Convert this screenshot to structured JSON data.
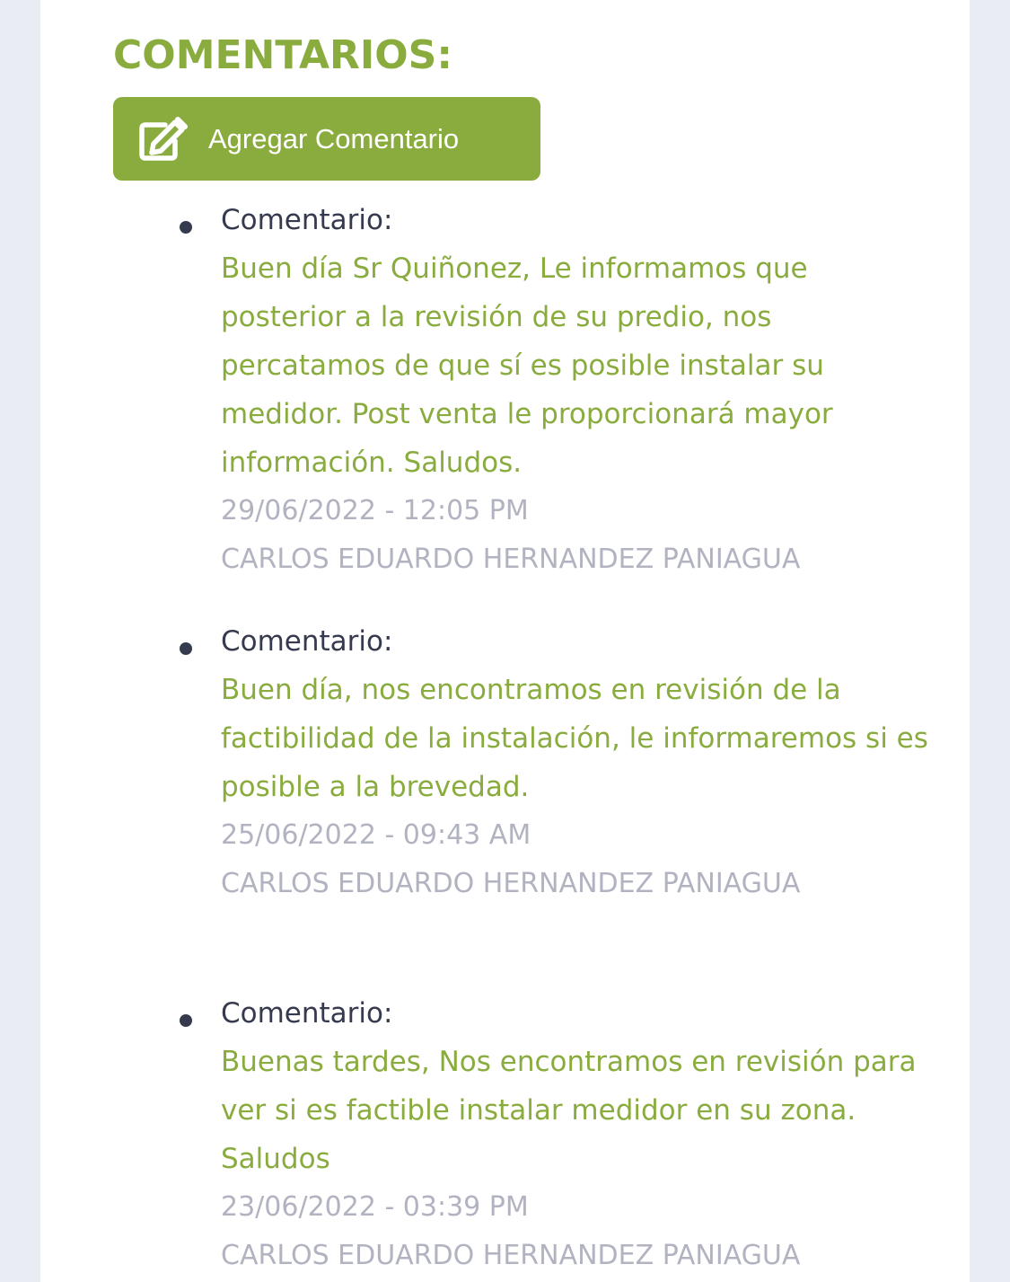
{
  "section": {
    "title": "COMENTARIOS:"
  },
  "add_button": {
    "label": "Agregar Comentario",
    "icon": "edit-icon"
  },
  "colors": {
    "accent": "#8aac3f",
    "label_dark": "#363a4e",
    "meta_gray": "#b2b3c1",
    "background": "#eaecf4"
  },
  "comments": [
    {
      "label": "Comentario:",
      "text": "Buen día Sr Quiñonez, Le informamos que posterior a la revisión de su predio, nos percatamos de que sí es posible instalar su medidor. Post venta le proporcionará mayor información. Saludos.",
      "date": "29/06/2022 - 12:05 PM",
      "author": "CARLOS EDUARDO HERNANDEZ PANIAGUA"
    },
    {
      "label": "Comentario:",
      "text": "Buen día, nos encontramos en revisión de la factibilidad de la instalación, le informaremos si es posible a la brevedad.",
      "date": "25/06/2022 - 09:43 AM",
      "author": "CARLOS EDUARDO HERNANDEZ PANIAGUA"
    },
    {
      "label": "Comentario:",
      "text": "Buenas tardes, Nos encontramos en revisión para ver si es factible instalar medidor en su zona. Saludos",
      "date": "23/06/2022 - 03:39 PM",
      "author": "CARLOS EDUARDO HERNANDEZ PANIAGUA"
    }
  ]
}
